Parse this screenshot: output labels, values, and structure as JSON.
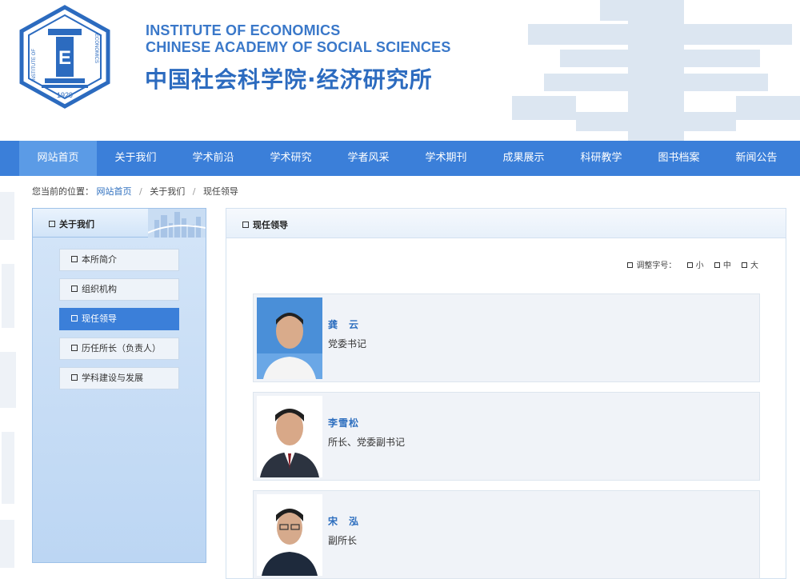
{
  "header": {
    "logo_text_ring_left": "INSTITUTE OF",
    "logo_text_ring_right": "ECONOMICS",
    "logo_year": "1929",
    "logo_letter": "E",
    "institute_en_line1": "INSTITUTE OF ECONOMICS",
    "institute_en_line2": "CHINESE ACADEMY OF SOCIAL SCIENCES",
    "institute_cn": "中国社会科学院·经济研究所"
  },
  "nav": {
    "items": [
      {
        "label": "网站首页",
        "active": true
      },
      {
        "label": "关于我们"
      },
      {
        "label": "学术前沿"
      },
      {
        "label": "学术研究"
      },
      {
        "label": "学者风采"
      },
      {
        "label": "学术期刊"
      },
      {
        "label": "成果展示"
      },
      {
        "label": "科研教学"
      },
      {
        "label": "图书档案"
      },
      {
        "label": "新闻公告"
      }
    ]
  },
  "breadcrumb": {
    "prefix": "您当前的位置：",
    "items": [
      "网站首页",
      "关于我们",
      "现任领导"
    ],
    "separator": "/"
  },
  "sidebar": {
    "title": "关于我们",
    "items": [
      {
        "label": "本所简介"
      },
      {
        "label": "组织机构"
      },
      {
        "label": "现任领导",
        "active": true
      },
      {
        "label": "历任所长（负责人）"
      },
      {
        "label": "学科建设与发展"
      }
    ]
  },
  "main": {
    "title": "现任领导",
    "font_size": {
      "label": "调整字号：",
      "small": "小",
      "medium": "中",
      "large": "大"
    },
    "leaders": [
      {
        "name": "龚　云",
        "title": "党委书记"
      },
      {
        "name": "李雪松",
        "title": "所长、党委副书记"
      },
      {
        "name": "宋　泓",
        "title": "副所长"
      }
    ]
  },
  "colors": {
    "nav_bg": "#3b7fd9",
    "nav_active": "#5b9be6",
    "brand_blue": "#2e6fbf",
    "sidebar_active": "#3b7fd9"
  }
}
